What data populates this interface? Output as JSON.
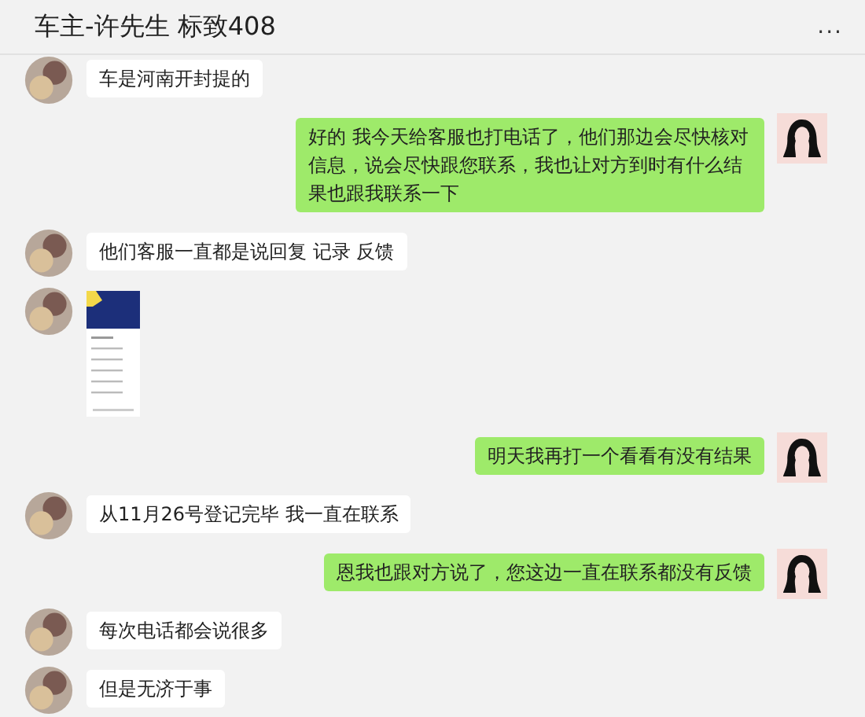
{
  "header": {
    "title": "车主-许先生 标致408",
    "menu": "..."
  },
  "messages": [
    {
      "outgoing": false,
      "kind": "text",
      "text": "车是河南开封提的"
    },
    {
      "outgoing": true,
      "kind": "text",
      "text": "好的 我今天给客服也打电话了，他们那边会尽快核对信息，说会尽快跟您联系，我也让对方到时有什么结果也跟我联系一下"
    },
    {
      "outgoing": false,
      "kind": "text",
      "text": "他们客服一直都是说回复 记录 反馈"
    },
    {
      "outgoing": false,
      "kind": "image"
    },
    {
      "outgoing": true,
      "kind": "text",
      "text": "明天我再打一个看看有没有结果"
    },
    {
      "outgoing": false,
      "kind": "text",
      "text": "从11月26号登记完毕 我一直在联系"
    },
    {
      "outgoing": true,
      "kind": "text",
      "text": "恩我也跟对方说了，您这边一直在联系都没有反馈"
    },
    {
      "outgoing": false,
      "kind": "text",
      "text": "每次电话都会说很多"
    },
    {
      "outgoing": false,
      "kind": "text",
      "text": "但是无济于事"
    }
  ]
}
